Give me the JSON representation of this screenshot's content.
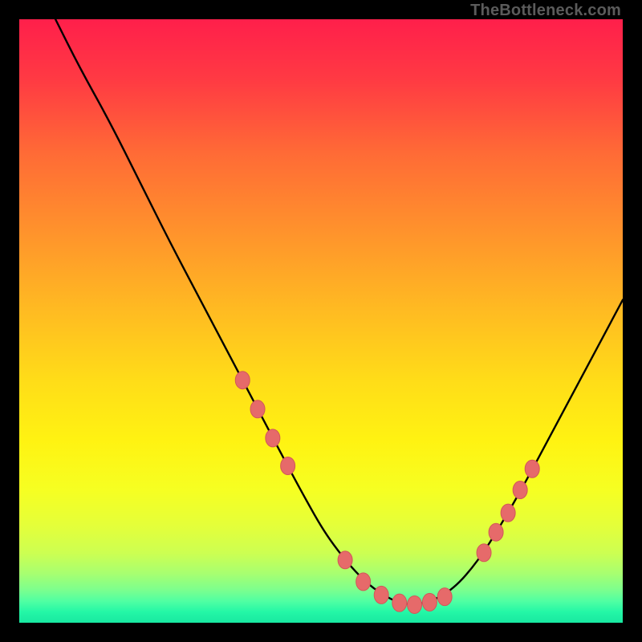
{
  "watermark": "TheBottleneck.com",
  "colors": {
    "marker": "#e66a6a",
    "marker_stroke": "#d15858",
    "curve": "#000000",
    "frame_bg": "#000000",
    "gradient_stops": [
      {
        "offset": 0.0,
        "color": "#ff1f4b"
      },
      {
        "offset": 0.1,
        "color": "#ff3a43"
      },
      {
        "offset": 0.22,
        "color": "#ff6a36"
      },
      {
        "offset": 0.35,
        "color": "#ff922c"
      },
      {
        "offset": 0.48,
        "color": "#ffba22"
      },
      {
        "offset": 0.6,
        "color": "#ffdd18"
      },
      {
        "offset": 0.7,
        "color": "#fff312"
      },
      {
        "offset": 0.78,
        "color": "#f6ff22"
      },
      {
        "offset": 0.84,
        "color": "#e4ff3a"
      },
      {
        "offset": 0.885,
        "color": "#ccff52"
      },
      {
        "offset": 0.918,
        "color": "#a8ff70"
      },
      {
        "offset": 0.945,
        "color": "#7dff8d"
      },
      {
        "offset": 0.965,
        "color": "#4effa3"
      },
      {
        "offset": 0.982,
        "color": "#24f7a6"
      },
      {
        "offset": 1.0,
        "color": "#18e8a1"
      }
    ]
  },
  "chart_data": {
    "type": "line",
    "title": "",
    "xlabel": "",
    "ylabel": "",
    "xlim": [
      0,
      100
    ],
    "ylim": [
      0,
      100
    ],
    "series": [
      {
        "name": "bottleneck-curve",
        "x": [
          6,
          10,
          15,
          20,
          25,
          30,
          35,
          40,
          45,
          48,
          50,
          52,
          55,
          58,
          61,
          63,
          65,
          68,
          72,
          76,
          80,
          84,
          88,
          92,
          96,
          100
        ],
        "y": [
          100,
          92,
          83,
          73,
          63,
          53.5,
          44,
          34.5,
          25,
          19.5,
          16,
          13,
          9.2,
          6.2,
          4.2,
          3.3,
          3.0,
          3.4,
          5.6,
          10.2,
          16.5,
          23.5,
          31,
          38.5,
          46,
          53.5
        ]
      }
    ],
    "markers": {
      "name": "highlighted-points",
      "x": [
        37,
        39.5,
        42,
        44.5,
        54,
        57,
        60,
        63,
        65.5,
        68,
        70.5,
        77,
        79,
        81,
        83,
        85
      ],
      "y": [
        40.2,
        35.4,
        30.6,
        26.0,
        10.4,
        6.8,
        4.6,
        3.3,
        3.0,
        3.4,
        4.3,
        11.6,
        15.0,
        18.2,
        22.0,
        25.5
      ]
    }
  }
}
